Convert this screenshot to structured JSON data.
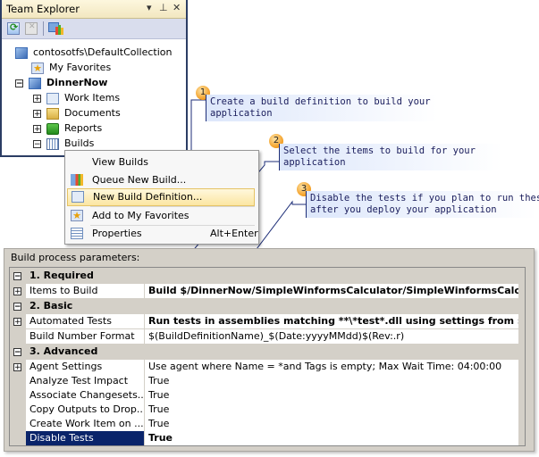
{
  "team_explorer": {
    "title": "Team Explorer",
    "controls": {
      "dropdown": "▾",
      "pin": "⊥",
      "close": "✕"
    },
    "toolbar": [
      {
        "icon": "refresh-icon"
      },
      {
        "icon": "stop-icon"
      },
      {
        "icon": "connect-team-project-icon"
      }
    ],
    "tree": [
      {
        "label": "contosotfs\\DefaultCollection",
        "icon": "team-collection-icon",
        "expander": null
      },
      {
        "label": "My Favorites",
        "icon": "favorites-star-icon",
        "expander": null
      },
      {
        "label": "DinnerNow",
        "icon": "team-project-icon",
        "expander": "−",
        "bold": true
      },
      {
        "label": "Work Items",
        "icon": "work-items-icon",
        "expander": "+"
      },
      {
        "label": "Documents",
        "icon": "folder-icon",
        "expander": "+"
      },
      {
        "label": "Reports",
        "icon": "reports-icon",
        "expander": "+"
      },
      {
        "label": "Builds",
        "icon": "builds-icon",
        "expander": "−"
      }
    ]
  },
  "context_menu": {
    "items": [
      {
        "label": "View Builds",
        "shortcut": ""
      },
      {
        "label": "Queue New Build...",
        "shortcut": ""
      },
      {
        "label": "New Build Definition...",
        "shortcut": "",
        "highlighted": true
      },
      {
        "label": "Add to My Favorites",
        "shortcut": ""
      },
      {
        "label": "Properties",
        "shortcut": "Alt+Enter"
      }
    ]
  },
  "callouts": [
    {
      "number": "1",
      "line1": "Create a build definition to build your",
      "line2": "application"
    },
    {
      "number": "2",
      "line1": "Select the items to build for your",
      "line2": "application"
    },
    {
      "number": "3",
      "line1": "Disable the tests if you plan to run these",
      "line2": "after you deploy your application"
    }
  ],
  "build_params": {
    "label": "Build process parameters:",
    "categories": [
      {
        "expander": "−",
        "label": "1. Required",
        "rows": [
          {
            "expander": "+",
            "name": "Items to Build",
            "value": "Build $/DinnerNow/SimpleWinformsCalculator/SimpleWinformsCalc...",
            "bold": true
          }
        ]
      },
      {
        "expander": "−",
        "label": "2. Basic",
        "rows": [
          {
            "expander": "+",
            "name": "Automated Tests",
            "value": "Run tests in assemblies matching **\\*test*.dll using settings from $/Dinn...",
            "bold": true
          },
          {
            "expander": "",
            "name": "Build Number Format",
            "value": "$(BuildDefinitionName)_$(Date:yyyyMMdd)$(Rev:.r)",
            "bold": false
          }
        ]
      },
      {
        "expander": "−",
        "label": "3. Advanced",
        "rows": [
          {
            "expander": "+",
            "name": "Agent Settings",
            "value": "Use agent where Name = *and Tags is empty; Max Wait Time: 04:00:00",
            "bold": false
          },
          {
            "expander": "",
            "name": "Analyze Test Impact",
            "value": "True",
            "bold": false
          },
          {
            "expander": "",
            "name": "Associate Changesets...",
            "value": "True",
            "bold": false
          },
          {
            "expander": "",
            "name": "Copy Outputs to Drop...",
            "value": "True",
            "bold": false
          },
          {
            "expander": "",
            "name": "Create Work Item on ...",
            "value": "True",
            "bold": false
          },
          {
            "expander": "",
            "name": "Disable Tests",
            "value": "True",
            "bold": true,
            "selected": true
          }
        ]
      }
    ]
  },
  "colors": {
    "callout_line": "#1c2d77",
    "selection": "#0a246a",
    "badge": "#f39c1f"
  }
}
